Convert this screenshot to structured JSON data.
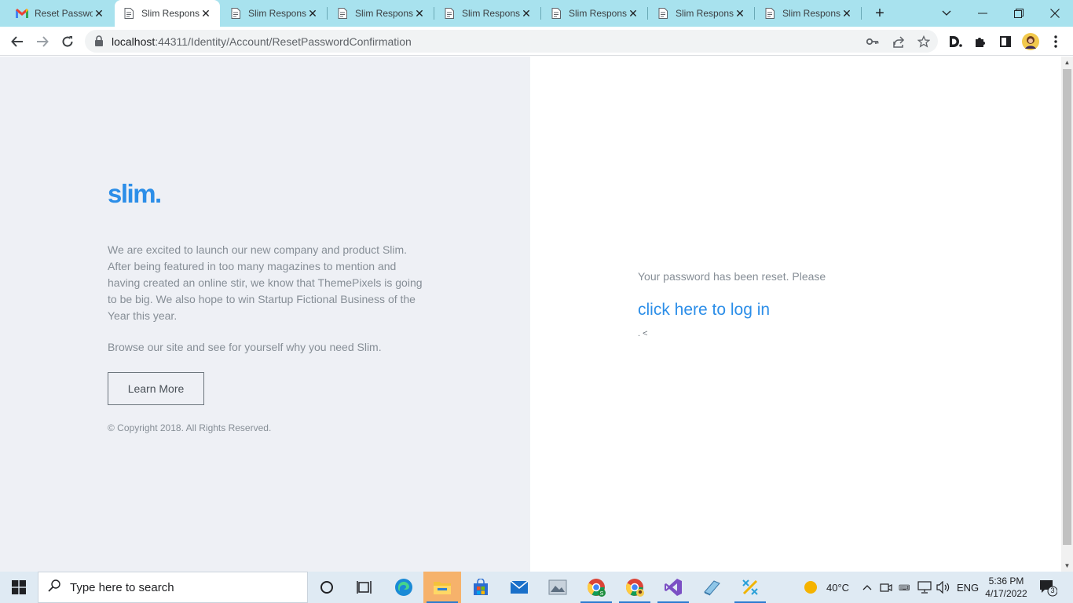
{
  "browser": {
    "tabs": [
      {
        "title": "Reset Passwo",
        "favicon": "gmail-icon",
        "active": false
      },
      {
        "title": "Slim Respons",
        "favicon": "page-icon",
        "active": true
      },
      {
        "title": "Slim Respons",
        "favicon": "page-icon",
        "active": false
      },
      {
        "title": "Slim Respons",
        "favicon": "page-icon",
        "active": false
      },
      {
        "title": "Slim Respons",
        "favicon": "page-icon",
        "active": false
      },
      {
        "title": "Slim Respons",
        "favicon": "page-icon",
        "active": false
      },
      {
        "title": "Slim Respons",
        "favicon": "page-icon",
        "active": false
      },
      {
        "title": "Slim Respons",
        "favicon": "page-icon",
        "active": false
      }
    ],
    "new_tab_label": "+",
    "url_host": "localhost",
    "url_rest": ":44311/Identity/Account/ResetPasswordConfirmation"
  },
  "left": {
    "logo": "slim.",
    "intro": "We are excited to launch our new company and product Slim. After being featured in too many magazines to mention and having created an online stir, we know that ThemePixels is going to be big. We also hope to win Startup Fictional Business of the Year this year.",
    "browse": "Browse our site and see for yourself why you need Slim.",
    "learn_more": "Learn More",
    "copyright": "© Copyright 2018. All Rights Reserved."
  },
  "right": {
    "message": "Your password has been reset. Please",
    "login_link": "click here to log in",
    "trailing": ". <"
  },
  "taskbar": {
    "search_placeholder": "Type here to search",
    "weather": "40°C",
    "language": "ENG",
    "time": "5:36 PM",
    "date": "4/17/2022",
    "notification_count": "3"
  },
  "colors": {
    "accent": "#2c8ee8",
    "tabbar": "#a8e2ee",
    "left_panel": "#eef0f5"
  }
}
